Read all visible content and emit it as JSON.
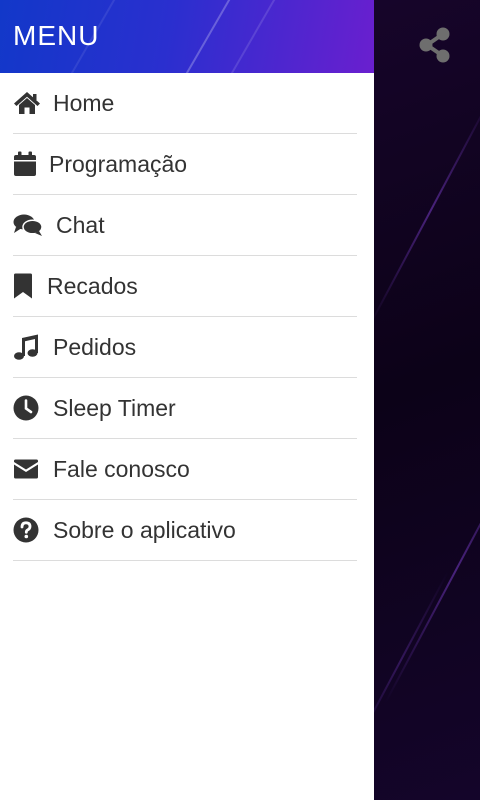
{
  "drawer": {
    "title": "MENU",
    "items": [
      {
        "label": "Home",
        "icon": "home-icon"
      },
      {
        "label": "Programação",
        "icon": "calendar-icon"
      },
      {
        "label": "Chat",
        "icon": "chat-icon"
      },
      {
        "label": "Recados",
        "icon": "bookmark-icon"
      },
      {
        "label": "Pedidos",
        "icon": "music-icon"
      },
      {
        "label": "Sleep Timer",
        "icon": "clock-icon"
      },
      {
        "label": "Fale conosco",
        "icon": "envelope-icon"
      },
      {
        "label": "Sobre o aplicativo",
        "icon": "question-circle-icon"
      }
    ]
  },
  "share": {
    "icon": "share-icon"
  },
  "colors": {
    "header_start": "#1238c9",
    "header_end": "#6a1fcf",
    "icon": "#333333",
    "text": "#333333",
    "divider": "#dcdcdc",
    "background": "#0c0218",
    "share_icon": "#6e6e6e"
  }
}
